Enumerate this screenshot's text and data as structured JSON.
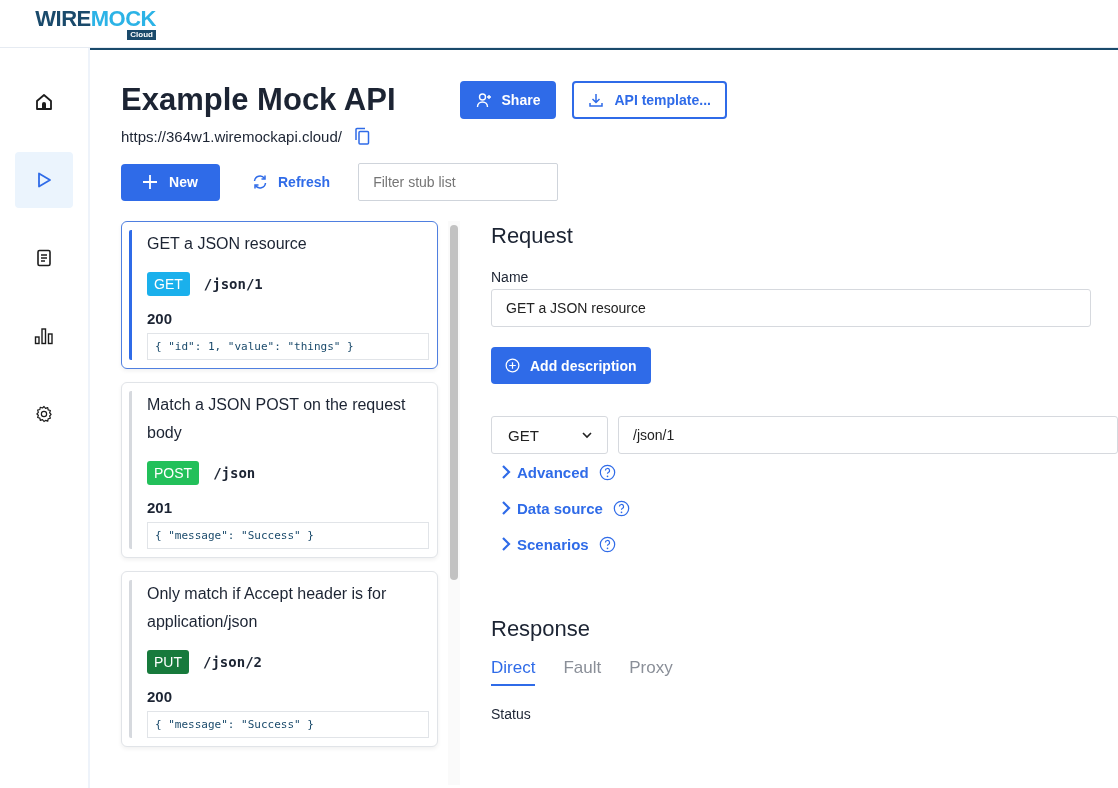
{
  "logo": {
    "primary": "WIRE",
    "secondary": "MOCK",
    "badge": "Cloud"
  },
  "sidebar": {
    "items": [
      {
        "kind": "home",
        "selected": false
      },
      {
        "kind": "play",
        "selected": true
      },
      {
        "kind": "document",
        "selected": false
      },
      {
        "kind": "chart",
        "selected": false
      },
      {
        "kind": "settings",
        "selected": false
      }
    ]
  },
  "header": {
    "title": "Example Mock API",
    "url": "https://364w1.wiremockapi.cloud/",
    "buttons": [
      {
        "kind": "share",
        "label": "Share"
      },
      {
        "kind": "template",
        "label": "API template..."
      }
    ]
  },
  "toolbar": {
    "new_label": "New",
    "refresh_label": "Refresh",
    "filter": {
      "placeholder": "Filter stub list"
    }
  },
  "stubs": [
    {
      "title": "GET a JSON resource",
      "method": "GET",
      "color": "#1ab0ec",
      "path": "/json/1",
      "status": "200",
      "body": "{ \"id\": 1, \"value\": \"things\" }",
      "selected": true
    },
    {
      "title": "Match a JSON POST on the request body",
      "method": "POST",
      "color": "#22c05a",
      "path": "/json",
      "status": "201",
      "body": "{ \"message\": \"Success\" }",
      "selected": false
    },
    {
      "title": "Only match if Accept header is for application/json",
      "method": "PUT",
      "color": "#177a3c",
      "path": "/json/2",
      "status": "200",
      "body": "{ \"message\": \"Success\" }",
      "selected": false
    }
  ],
  "request": {
    "heading": "Request",
    "name_label": "Name",
    "name_value": "GET a JSON resource",
    "add_description": "Add description",
    "method": "GET",
    "url": "/json/1",
    "sections": [
      {
        "label": "Advanced",
        "expanded": false
      },
      {
        "label": "Data source",
        "expanded": false
      },
      {
        "label": "Scenarios",
        "expanded": false
      }
    ]
  },
  "response": {
    "heading": "Response",
    "tabs": [
      {
        "label": "Direct",
        "selected": true
      },
      {
        "label": "Fault",
        "selected": false
      },
      {
        "label": "Proxy",
        "selected": false
      }
    ],
    "status_label": "Status"
  }
}
